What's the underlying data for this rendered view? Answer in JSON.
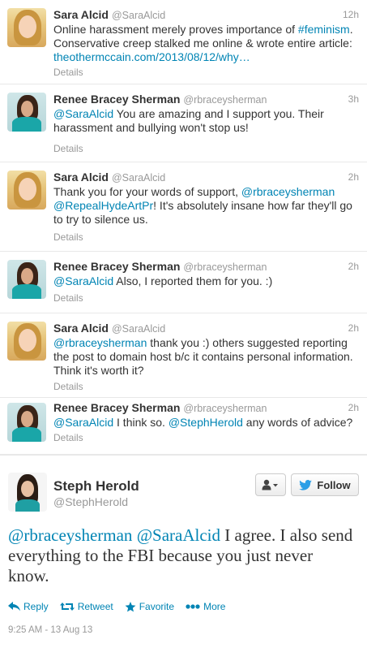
{
  "colors": {
    "link": "#0084b4",
    "muted": "#999999",
    "text": "#333333",
    "twitter_bird": "#2b9ee6"
  },
  "replies": [
    {
      "name": "Sara Alcid",
      "handle": "@SaraAlcid",
      "time": "12h",
      "text": {
        "p1": "Online harassment merely proves importance of ",
        "tag": "#feminism",
        "p2": ". Conservative creep stalked me online & wrote entire article: ",
        "url": "theothermccain.com/2013/08/12/why…"
      },
      "details": "Details"
    },
    {
      "name": "Renee Bracey Sherman",
      "handle": "@rbraceysherman",
      "time": "3h",
      "text": {
        "m1": "@SaraAlcid",
        "p1": " You are amazing and I support you. Their harassment and bullying won't stop us!"
      },
      "details": "Details"
    },
    {
      "name": "Sara Alcid",
      "handle": "@SaraAlcid",
      "time": "2h",
      "text": {
        "p1": "Thank you for your words of support, ",
        "m1": "@rbraceysherman",
        "m2": "@RepealHydeArtPr",
        "p2": "! It's absolutely insane how far they'll go to try to silence us."
      },
      "details": "Details"
    },
    {
      "name": "Renee Bracey Sherman",
      "handle": "@rbraceysherman",
      "time": "2h",
      "text": {
        "m1": "@SaraAlcid",
        "p1": " Also, I reported them for you. :)"
      },
      "details": "Details"
    },
    {
      "name": "Sara Alcid",
      "handle": "@SaraAlcid",
      "time": "2h",
      "text": {
        "m1": "@rbraceysherman",
        "p1": " thank you :) others suggested reporting the post to domain host b/c it contains personal information. Think it's worth it?"
      },
      "details": "Details"
    },
    {
      "name": "Renee Bracey Sherman",
      "handle": "@rbraceysherman",
      "time": "2h",
      "text": {
        "m1": "@SaraAlcid",
        "p1": " I think so. ",
        "m2": "@StephHerold",
        "p2": " any words of advice?"
      },
      "details": "Details"
    }
  ],
  "main": {
    "name": "Steph Herold",
    "handle": "@StephHerold",
    "follow_label": "Follow",
    "text": {
      "m1": "@rbraceysherman",
      "m2": "@SaraAlcid",
      "p1": " I agree. I also send everything to the FBI because you just never know."
    },
    "actions": {
      "reply": "Reply",
      "retweet": "Retweet",
      "favorite": "Favorite",
      "more": "More"
    },
    "timestamp": "9:25 AM - 13 Aug 13"
  }
}
